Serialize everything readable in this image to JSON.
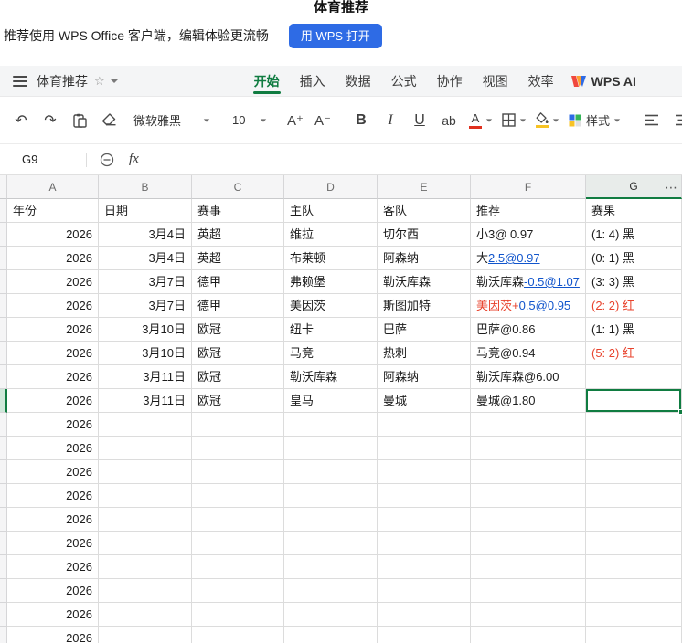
{
  "page_title": "体育推荐",
  "banner": {
    "message": "推荐使用 WPS Office 客户端，编辑体验更流畅",
    "button_label": "用 WPS 打开"
  },
  "menu": {
    "doc_title": "体育推荐",
    "tabs": [
      "开始",
      "插入",
      "数据",
      "公式",
      "协作",
      "视图",
      "效率"
    ],
    "active_tab": "开始",
    "ai_label": "WPS AI"
  },
  "toolbar": {
    "undo": "↶",
    "redo": "↷",
    "font_name": "微软雅黑",
    "font_size": "10",
    "increase_font": "A⁺",
    "decrease_font": "A⁻",
    "bold": "B",
    "italic": "I",
    "underline": "U",
    "strikethrough": "ab",
    "font_color_letter": "A",
    "styles_label": "样式"
  },
  "formula_bar": {
    "cell_ref": "G9",
    "fx_label": "fx"
  },
  "sheet": {
    "columns": [
      "A",
      "B",
      "C",
      "D",
      "E",
      "F",
      "G"
    ],
    "more_label": "⋯",
    "headers": [
      "年份",
      "日期",
      "赛事",
      "主队",
      "客队",
      "推荐",
      "赛果"
    ],
    "selection": "G9",
    "rows": [
      {
        "year": "2026",
        "date": "3月4日",
        "event": "英超",
        "home": "维拉",
        "away": "切尔西",
        "tip": [
          {
            "text": "小3@ 0.97",
            "style": "plain"
          }
        ],
        "result": "(1: 4) 黑",
        "result_red": false
      },
      {
        "year": "2026",
        "date": "3月4日",
        "event": "英超",
        "home": "布莱顿",
        "away": "阿森纳",
        "tip": [
          {
            "text": "大",
            "style": "plain"
          },
          {
            "text": "2.5@0.97",
            "style": "link"
          }
        ],
        "result": "(0: 1) 黑",
        "result_red": false
      },
      {
        "year": "2026",
        "date": "3月7日",
        "event": "德甲",
        "home": "弗赖堡",
        "away": "勒沃库森",
        "tip": [
          {
            "text": "勒沃库森",
            "style": "plain"
          },
          {
            "text": "-0.5@1.07",
            "style": "link"
          }
        ],
        "result": "(3: 3) 黑",
        "result_red": false
      },
      {
        "year": "2026",
        "date": "3月7日",
        "event": "德甲",
        "home": "美因茨",
        "away": "斯图加特",
        "tip": [
          {
            "text": "美因茨+",
            "style": "red"
          },
          {
            "text": "0.5@0.95",
            "style": "link"
          }
        ],
        "result": "(2: 2) 红",
        "result_red": true
      },
      {
        "year": "2026",
        "date": "3月10日",
        "event": "欧冠",
        "home": "纽卡",
        "away": "巴萨",
        "tip": [
          {
            "text": "巴萨@0.86",
            "style": "plain"
          }
        ],
        "result": "(1: 1) 黑",
        "result_red": false
      },
      {
        "year": "2026",
        "date": "3月10日",
        "event": "欧冠",
        "home": "马竞",
        "away": "热刺",
        "tip": [
          {
            "text": "马竞@0.94",
            "style": "plain"
          }
        ],
        "result": "(5: 2) 红",
        "result_red": true
      },
      {
        "year": "2026",
        "date": "3月11日",
        "event": "欧冠",
        "home": "勒沃库森",
        "away": "阿森纳",
        "tip": [
          {
            "text": "勒沃库森@6.00",
            "style": "plain"
          }
        ],
        "result": "",
        "result_red": false
      },
      {
        "year": "2026",
        "date": "3月11日",
        "event": "欧冠",
        "home": "皇马",
        "away": "曼城",
        "tip": [
          {
            "text": "曼城@1.80",
            "style": "plain"
          }
        ],
        "result": "",
        "result_red": false,
        "selected": true
      }
    ],
    "extra_rows": [
      "2026",
      "2026",
      "2026",
      "2026",
      "2026",
      "2026",
      "2026",
      "2026",
      "2026",
      "2026"
    ]
  },
  "colors": {
    "accent_green": "#107C41",
    "link_blue": "#1155CC",
    "alert_red": "#E8432D",
    "button_blue": "#2E6BE5"
  }
}
